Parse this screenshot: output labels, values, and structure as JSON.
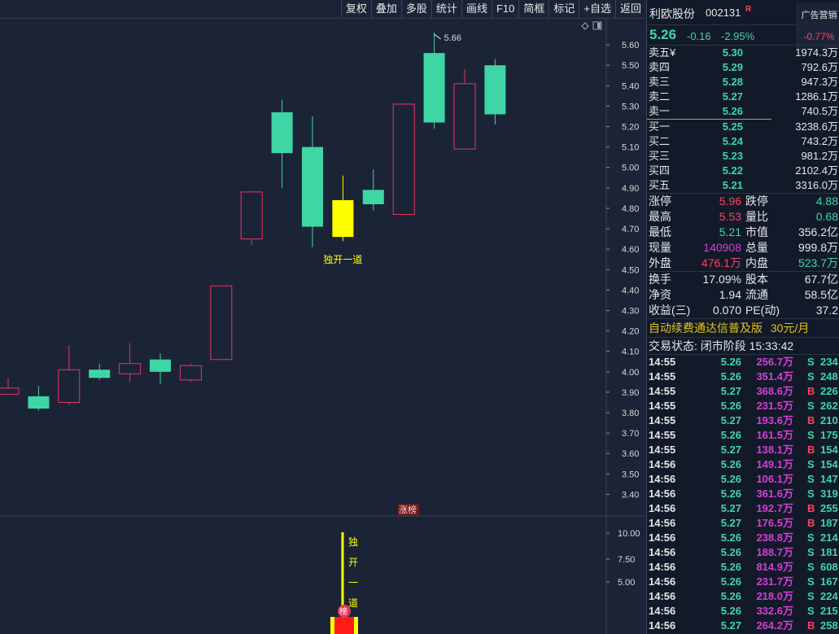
{
  "toolbar": {
    "buttons": [
      "复权",
      "叠加",
      "多股",
      "统计",
      "画线",
      "F10",
      "简框",
      "标记",
      "+自选",
      "返回"
    ]
  },
  "chart": {
    "high_marker": "5.66",
    "annotation": "独开一道",
    "badge_mid": "涨榜",
    "vol_axis": [
      "10.00",
      "7.50",
      "5.00"
    ],
    "vol_vertical_text": [
      "独",
      "开",
      "一",
      "道"
    ],
    "vol_badge": "榜",
    "price_axis": [
      "5.60",
      "5.50",
      "5.40",
      "5.30",
      "5.20",
      "5.10",
      "5.00",
      "4.90",
      "4.80",
      "4.70",
      "4.60",
      "4.50",
      "4.40",
      "4.30",
      "4.20",
      "4.10",
      "4.00",
      "3.90",
      "3.80",
      "3.70",
      "3.60",
      "3.50",
      "3.40"
    ],
    "colors": {
      "up": "#e8365d",
      "down": "#3fd6a6",
      "highlight": "#ffff00"
    }
  },
  "chart_data": {
    "type": "candlestick",
    "yrange": [
      3.35,
      5.7
    ],
    "candles": [
      {
        "o": 3.89,
        "c": 3.92,
        "h": 3.97,
        "l": 3.89,
        "up": true
      },
      {
        "o": 3.88,
        "c": 3.82,
        "h": 3.93,
        "l": 3.81,
        "up": false
      },
      {
        "o": 3.85,
        "c": 4.01,
        "h": 4.13,
        "l": 3.84,
        "up": true
      },
      {
        "o": 4.01,
        "c": 3.97,
        "h": 4.04,
        "l": 3.96,
        "up": false
      },
      {
        "o": 3.99,
        "c": 4.04,
        "h": 4.14,
        "l": 3.95,
        "up": true
      },
      {
        "o": 4.06,
        "c": 4.0,
        "h": 4.09,
        "l": 3.94,
        "up": false
      },
      {
        "o": 3.96,
        "c": 4.03,
        "h": 4.04,
        "l": 3.95,
        "up": true
      },
      {
        "o": 4.06,
        "c": 4.42,
        "h": 4.42,
        "l": 4.06,
        "up": true
      },
      {
        "o": 4.65,
        "c": 4.88,
        "h": 4.88,
        "l": 4.62,
        "up": true
      },
      {
        "o": 5.27,
        "c": 5.07,
        "h": 5.33,
        "l": 4.9,
        "up": false
      },
      {
        "o": 5.1,
        "c": 4.71,
        "h": 5.25,
        "l": 4.61,
        "up": false
      },
      {
        "o": 4.84,
        "c": 4.66,
        "h": 4.96,
        "l": 4.64,
        "up": false,
        "highlight": true
      },
      {
        "o": 4.89,
        "c": 4.82,
        "h": 4.99,
        "l": 4.79,
        "up": false
      },
      {
        "o": 4.77,
        "c": 5.31,
        "h": 5.31,
        "l": 4.77,
        "up": true
      },
      {
        "o": 5.56,
        "c": 5.22,
        "h": 5.66,
        "l": 5.19,
        "up": false
      },
      {
        "o": 5.09,
        "c": 5.41,
        "h": 5.48,
        "l": 5.09,
        "up": true
      },
      {
        "o": 5.5,
        "c": 5.26,
        "h": 5.53,
        "l": 5.21,
        "up": false
      }
    ]
  },
  "quote": {
    "name": "利欧股份",
    "code": "002131",
    "rmark": "R",
    "ad_title": "广告营销",
    "ad_pct": "-0.77%",
    "price": "5.26",
    "change": "-0.16",
    "change_pct": "-2.95%",
    "asks": [
      {
        "label": "卖五",
        "price": "5.30",
        "vol": "1974.3万",
        "cls": "green"
      },
      {
        "label": "卖四",
        "price": "5.29",
        "vol": "792.6万",
        "cls": "green"
      },
      {
        "label": "卖三",
        "price": "5.28",
        "vol": "947.3万",
        "cls": "green"
      },
      {
        "label": "卖二",
        "price": "5.27",
        "vol": "1286.1万",
        "cls": "green"
      },
      {
        "label": "卖一",
        "price": "5.26",
        "vol": "740.5万",
        "cls": "green"
      }
    ],
    "ask_marker": "¥",
    "bids": [
      {
        "label": "买一",
        "price": "5.25",
        "vol": "3238.6万",
        "cls": "green"
      },
      {
        "label": "买二",
        "price": "5.24",
        "vol": "743.2万",
        "cls": "green"
      },
      {
        "label": "买三",
        "price": "5.23",
        "vol": "981.2万",
        "cls": "green"
      },
      {
        "label": "买四",
        "price": "5.22",
        "vol": "2102.4万",
        "cls": "green"
      },
      {
        "label": "买五",
        "price": "5.21",
        "vol": "3316.0万",
        "cls": "green"
      }
    ],
    "stats1": [
      {
        "l1": "涨停",
        "v1": "5.96",
        "c1": "red",
        "l2": "跌停",
        "v2": "4.88",
        "c2": "green"
      },
      {
        "l1": "最高",
        "v1": "5.53",
        "c1": "red",
        "l2": "量比",
        "v2": "0.68",
        "c2": "green"
      },
      {
        "l1": "最低",
        "v1": "5.21",
        "c1": "green",
        "l2": "市值",
        "v2": "356.2亿",
        "c2": "white"
      },
      {
        "l1": "现量",
        "v1": "140908",
        "c1": "magenta",
        "l2": "总量",
        "v2": "999.8万",
        "c2": "white"
      },
      {
        "l1": "外盘",
        "v1": "476.1万",
        "c1": "red",
        "l2": "内盘",
        "v2": "523.7万",
        "c2": "green"
      }
    ],
    "stats2": [
      {
        "l1": "换手",
        "v1": "17.09%",
        "c1": "white",
        "l2": "股本",
        "v2": "67.7亿",
        "c2": "white"
      },
      {
        "l1": "净资",
        "v1": "1.94",
        "c1": "white",
        "l2": "流通",
        "v2": "58.5亿",
        "c2": "white"
      },
      {
        "l1": "收益(三)",
        "v1": "0.070",
        "c1": "white",
        "l2": "PE(动)",
        "v2": "37.2",
        "c2": "white"
      }
    ],
    "promo_text": "自动续费通达信普及版",
    "promo_price": "30元/月",
    "status": "交易状态: 闭市阶段 15:33:42"
  },
  "ticks": [
    {
      "t": "14:55",
      "p": "5.26",
      "a": "256.7万",
      "s": "S",
      "n": "234"
    },
    {
      "t": "14:55",
      "p": "5.26",
      "a": "351.4万",
      "s": "S",
      "n": "248"
    },
    {
      "t": "14:55",
      "p": "5.27",
      "a": "368.6万",
      "s": "B",
      "n": "226"
    },
    {
      "t": "14:55",
      "p": "5.26",
      "a": "231.5万",
      "s": "S",
      "n": "262"
    },
    {
      "t": "14:55",
      "p": "5.27",
      "a": "193.6万",
      "s": "B",
      "n": "210"
    },
    {
      "t": "14:55",
      "p": "5.26",
      "a": "161.5万",
      "s": "S",
      "n": "175"
    },
    {
      "t": "14:55",
      "p": "5.27",
      "a": "138.1万",
      "s": "B",
      "n": "154"
    },
    {
      "t": "14:56",
      "p": "5.26",
      "a": "149.1万",
      "s": "S",
      "n": "154"
    },
    {
      "t": "14:56",
      "p": "5.26",
      "a": "106.1万",
      "s": "S",
      "n": "147"
    },
    {
      "t": "14:56",
      "p": "5.26",
      "a": "361.6万",
      "s": "S",
      "n": "319"
    },
    {
      "t": "14:56",
      "p": "5.27",
      "a": "192.7万",
      "s": "B",
      "n": "255"
    },
    {
      "t": "14:56",
      "p": "5.27",
      "a": "176.5万",
      "s": "B",
      "n": "187"
    },
    {
      "t": "14:56",
      "p": "5.26",
      "a": "238.8万",
      "s": "S",
      "n": "214"
    },
    {
      "t": "14:56",
      "p": "5.26",
      "a": "188.7万",
      "s": "S",
      "n": "181"
    },
    {
      "t": "14:56",
      "p": "5.26",
      "a": "814.9万",
      "s": "S",
      "n": "608"
    },
    {
      "t": "14:56",
      "p": "5.26",
      "a": "231.7万",
      "s": "S",
      "n": "167"
    },
    {
      "t": "14:56",
      "p": "5.26",
      "a": "218.0万",
      "s": "S",
      "n": "224"
    },
    {
      "t": "14:56",
      "p": "5.26",
      "a": "332.6万",
      "s": "S",
      "n": "215"
    },
    {
      "t": "14:56",
      "p": "5.27",
      "a": "264.2万",
      "s": "B",
      "n": "258"
    }
  ]
}
